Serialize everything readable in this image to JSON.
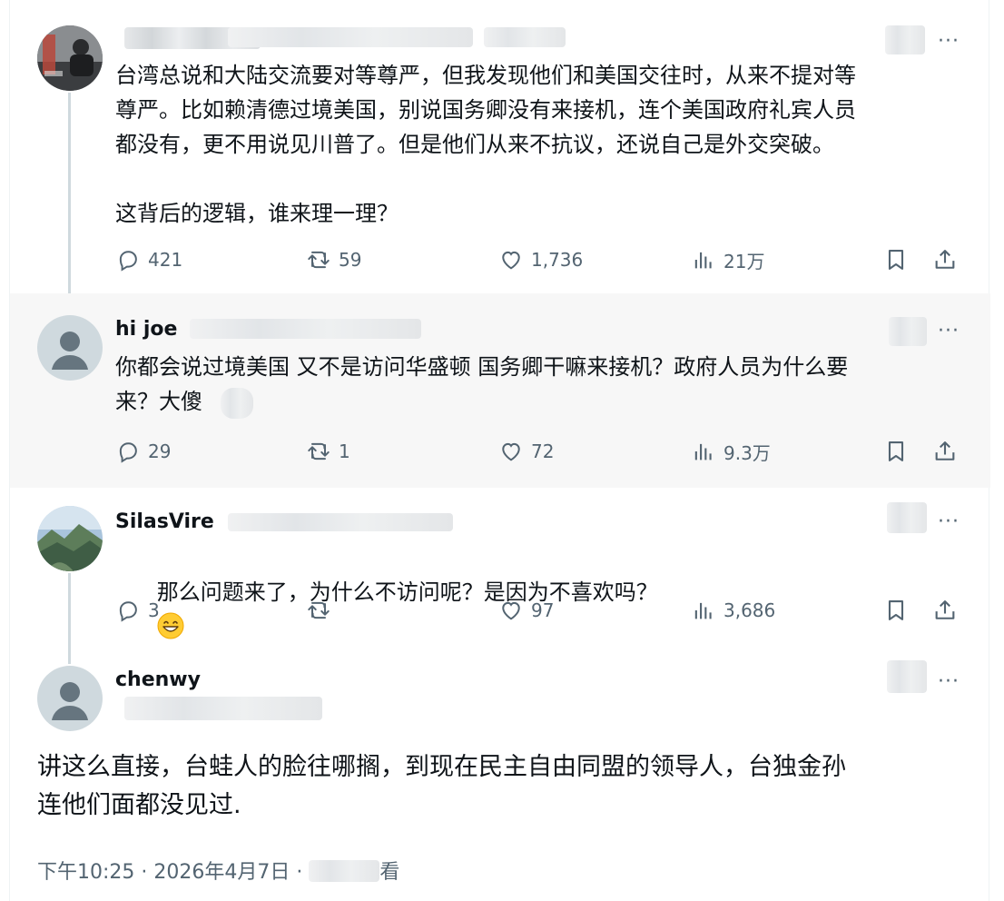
{
  "posts": [
    {
      "name": "",
      "text": "台湾总说和大陆交流要对等尊严，但我发现他们和美国交往时，从来不提对等\n尊严。比如赖清德过境美国，别说国务卿没有来接机，连个美国政府礼宾人员\n都没有，更不用说见川普了。但是他们从来不抗议，还说自己是外交突破。\n\n这背后的逻辑，谁来理一理？",
      "replies": "421",
      "retweets": "59",
      "likes": "1,736",
      "views": "21万"
    },
    {
      "name": "hi joe",
      "text": "你都会说过境美国 又不是访问华盛顿 国务卿干嘛来接机？政府人员为什么要\n来？大傻",
      "replies": "29",
      "retweets": "1",
      "likes": "72",
      "views": "9.3万"
    },
    {
      "name": "SilasVire",
      "text": "那么问题来了，为什么不访问呢？是因为不喜欢吗？",
      "replies": "3",
      "retweets": "",
      "likes": "97",
      "views": "3,686"
    }
  ],
  "main_post": {
    "name": "chenwy",
    "text": "讲这么直接，台蛙人的脸往哪搁，到现在民主自由同盟的领导人，台独金孙\n连他们面都没见过.",
    "meta_time": "下午10:25 · 2026年4月7日 · ",
    "meta_suffix": "看"
  },
  "more_label": "···",
  "colors": {
    "text": "#0f1419",
    "muted": "#536471",
    "line": "#cfd9de",
    "alt_bg": "#f7f7f7"
  },
  "icons": [
    "reply-icon",
    "retweet-icon",
    "like-icon",
    "views-icon",
    "bookmark-icon",
    "share-icon",
    "more-icon",
    "grinning-emoji"
  ]
}
